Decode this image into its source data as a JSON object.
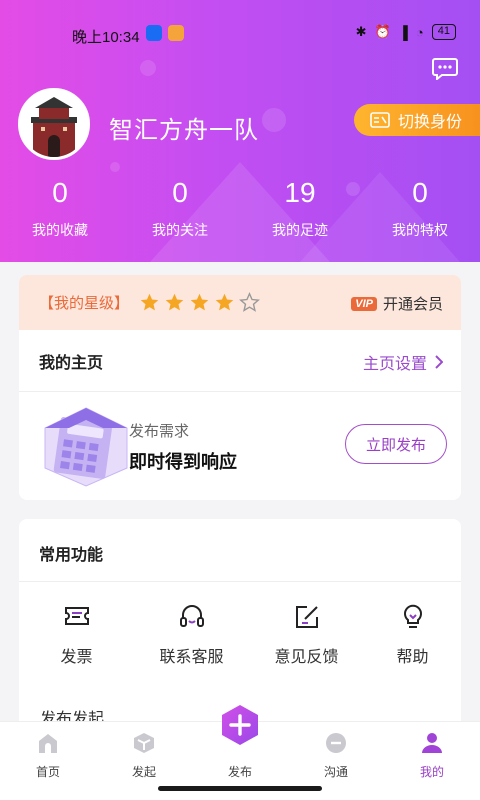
{
  "status": {
    "time": "晚上10:34",
    "battery": "41"
  },
  "profile": {
    "name": "智汇方舟一队",
    "switch_label": "切换身份"
  },
  "stats": [
    {
      "value": "0",
      "label": "我的收藏"
    },
    {
      "value": "0",
      "label": "我的关注"
    },
    {
      "value": "19",
      "label": "我的足迹"
    },
    {
      "value": "0",
      "label": "我的特权"
    }
  ],
  "rating": {
    "label": "【我的星级】",
    "stars": 4,
    "max": 5,
    "vip_badge": "VIP",
    "vip_label": "开通会员"
  },
  "homepage": {
    "title": "我的主页",
    "settings_label": "主页设置"
  },
  "publish": {
    "subtitle": "发布需求",
    "title": "即时得到响应",
    "button": "立即发布"
  },
  "functions": {
    "title": "常用功能",
    "items": [
      {
        "label": "发票",
        "icon": "ticket-icon"
      },
      {
        "label": "联系客服",
        "icon": "headset-icon"
      },
      {
        "label": "意见反馈",
        "icon": "edit-icon"
      },
      {
        "label": "帮助",
        "icon": "lightbulb-icon"
      }
    ],
    "next_section": "发布发起"
  },
  "tabs": [
    {
      "label": "首页",
      "icon": "home-icon"
    },
    {
      "label": "发起",
      "icon": "cube-icon"
    },
    {
      "label": "发布",
      "icon": "plus-hexagon-icon"
    },
    {
      "label": "沟通",
      "icon": "chat-icon"
    },
    {
      "label": "我的",
      "icon": "user-icon"
    }
  ],
  "colors": {
    "header_start": "#e44ce6",
    "header_end": "#a44ff3",
    "accent": "#9a3fc5",
    "orange": "#f7901e",
    "star": "#f5a623"
  }
}
